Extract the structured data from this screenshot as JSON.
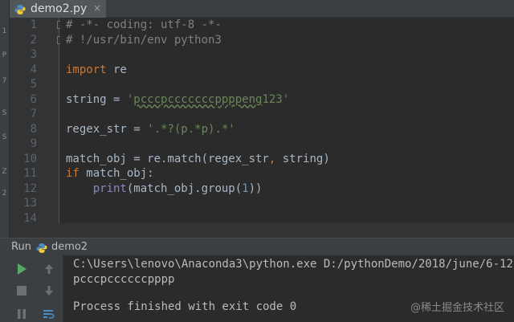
{
  "tab": {
    "filename": "demo2.py",
    "close": "×"
  },
  "left_strip": {
    "marks": [
      "1",
      "P",
      "7",
      "S",
      "S",
      "Z",
      "2"
    ]
  },
  "editor": {
    "line_numbers": [
      "1",
      "2",
      "3",
      "4",
      "5",
      "6",
      "7",
      "8",
      "9",
      "10",
      "11",
      "12",
      "13",
      "14"
    ],
    "lines": {
      "l1": "# -*- coding: utf-8 -*-",
      "l2": "# !/usr/bin/env python3",
      "l4_kw": "import",
      "l4_rest": " re",
      "l6_a": "string = ",
      "l6_q1": "'",
      "l6_val": "pcccpcccccccppppeng",
      "l6_num": "123",
      "l6_q2": "'",
      "l8_a": "regex_str = ",
      "l8_str": "'.*?(p.*p).*'",
      "l10_a": "match_obj = re.match(regex_str",
      "l10_comma": ",",
      "l10_b": " string)",
      "l11_kw": "if",
      "l11_rest": " match_obj:",
      "l12_indent": "    ",
      "l12_fn": "print",
      "l12_a": "(match_obj.group(",
      "l12_num": "1",
      "l12_b": "))"
    }
  },
  "run": {
    "label": "Run",
    "config": "demo2",
    "console": [
      "C:\\Users\\lenovo\\Anaconda3\\python.exe D:/pythonDemo/2018/june/6-12",
      "pcccpccccccpppp",
      "",
      "Process finished with exit code 0"
    ]
  },
  "watermark": "@稀土掘金技术社区",
  "colors": {
    "background": "#2b2b2b",
    "keyword": "#cc7832",
    "string": "#6a8759",
    "number": "#6897bb",
    "comment": "#808080",
    "run_green": "#59a869"
  }
}
